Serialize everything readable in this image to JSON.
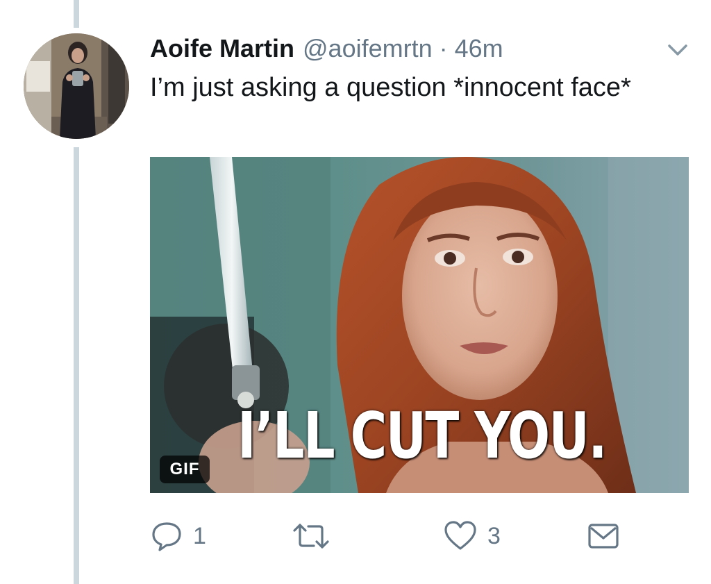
{
  "tweet": {
    "display_name": "Aoife Martin",
    "handle": "@aoifemrtn",
    "separator": "·",
    "timestamp": "46m",
    "text": "I’m just asking a question *innocent face*",
    "avatar_icon": "avatar-photo",
    "caret_icon": "chevron-down-icon"
  },
  "media": {
    "type": "gif",
    "caption": "I’LL CUT YOU.",
    "badge": "GIF"
  },
  "actions": {
    "reply": {
      "icon": "reply-icon",
      "count": "1"
    },
    "retweet": {
      "icon": "retweet-icon",
      "count": ""
    },
    "like": {
      "icon": "heart-icon",
      "count": "3"
    },
    "message": {
      "icon": "envelope-icon",
      "count": ""
    }
  },
  "colors": {
    "text_primary": "#14171a",
    "text_secondary": "#657786",
    "thread_line": "#ccd6dd",
    "background": "#ffffff"
  }
}
